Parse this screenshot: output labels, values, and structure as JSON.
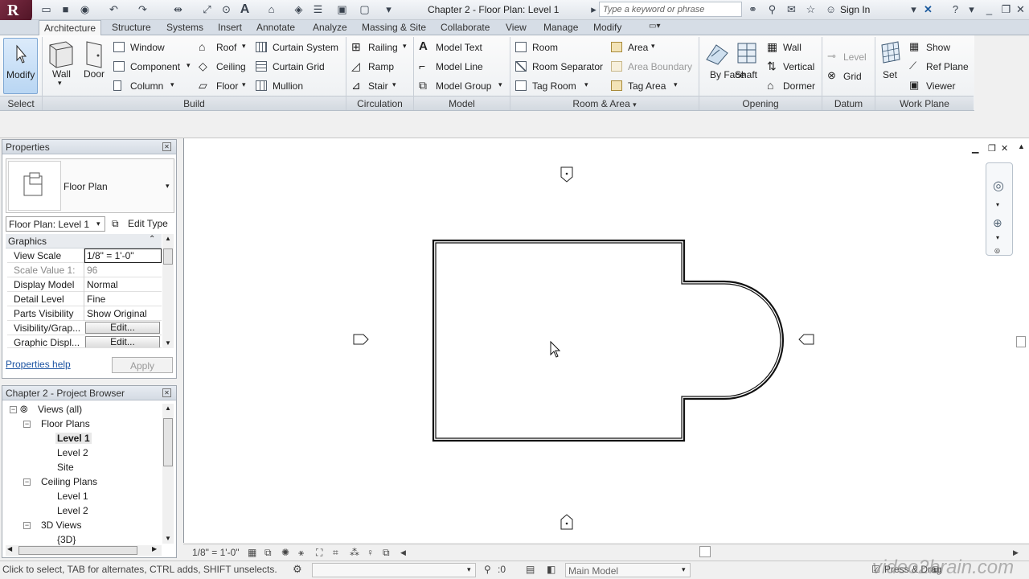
{
  "app": {
    "title": "Chapter 2 - Floor Plan: Level 1",
    "logo_letter": "R",
    "search_placeholder": "Type a keyword or phrase",
    "sign_in": "Sign In"
  },
  "tabs": [
    "Architecture",
    "Structure",
    "Systems",
    "Insert",
    "Annotate",
    "Analyze",
    "Massing & Site",
    "Collaborate",
    "View",
    "Manage",
    "Modify"
  ],
  "ribbon": {
    "select": {
      "modify": "Modify",
      "panel": "Select"
    },
    "build": {
      "wall": "Wall",
      "door": "Door",
      "window": "Window",
      "component": "Component",
      "column": "Column",
      "roof": "Roof",
      "ceiling": "Ceiling",
      "floor": "Floor",
      "curtain_system": "Curtain System",
      "curtain_grid": "Curtain Grid",
      "mullion": "Mullion",
      "panel": "Build"
    },
    "circulation": {
      "railing": "Railing",
      "ramp": "Ramp",
      "stair": "Stair",
      "panel": "Circulation"
    },
    "model": {
      "text": "Model Text",
      "line": "Model Line",
      "group": "Model Group",
      "panel": "Model"
    },
    "room_area": {
      "room": "Room",
      "room_separator": "Room Separator",
      "tag_room": "Tag Room",
      "area": "Area",
      "area_boundary": "Area Boundary",
      "tag_area": "Tag Area",
      "panel": "Room & Area"
    },
    "opening": {
      "by_face": "By Face",
      "shaft": "Shaft",
      "wall": "Wall",
      "vertical": "Vertical",
      "dormer": "Dormer",
      "panel": "Opening"
    },
    "datum": {
      "level": "Level",
      "grid": "Grid",
      "panel": "Datum"
    },
    "work_plane": {
      "set": "Set",
      "show": "Show",
      "ref_plane": "Ref Plane",
      "viewer": "Viewer",
      "panel": "Work Plane"
    }
  },
  "properties": {
    "title": "Properties",
    "type_name": "Floor Plan",
    "instance_selector": "Floor Plan: Level 1",
    "edit_type": "Edit Type",
    "group": "Graphics",
    "rows": [
      {
        "key": "View Scale",
        "value": "1/8\" = 1'-0\""
      },
      {
        "key": "Scale Value    1:",
        "value": "96"
      },
      {
        "key": "Display Model",
        "value": "Normal"
      },
      {
        "key": "Detail Level",
        "value": "Fine"
      },
      {
        "key": "Parts Visibility",
        "value": "Show Original"
      },
      {
        "key": "Visibility/Grap...",
        "value": "Edit..."
      },
      {
        "key": "Graphic Displ...",
        "value": "Edit..."
      }
    ],
    "help": "Properties help",
    "apply": "Apply"
  },
  "browser": {
    "title": "Chapter 2 - Project Browser",
    "items": {
      "views": "Views (all)",
      "floor_plans": "Floor Plans",
      "fp_level1": "Level 1",
      "fp_level2": "Level 2",
      "fp_site": "Site",
      "ceiling_plans": "Ceiling Plans",
      "cp_level1": "Level 1",
      "cp_level2": "Level 2",
      "views_3d": "3D Views",
      "v3d": "{3D}"
    }
  },
  "viewbar": {
    "scale": "1/8\" = 1'-0\""
  },
  "status": {
    "message": "Click to select, TAB for alternates, CTRL adds, SHIFT unselects.",
    "count": ":0",
    "model": "Main Model",
    "press_drag": "Press & Drag",
    "watermark": "video2brain.com"
  }
}
